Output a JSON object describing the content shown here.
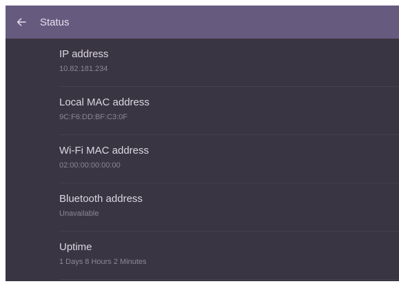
{
  "appbar": {
    "title": "Status",
    "back_icon": "arrow-left-icon"
  },
  "colors": {
    "appbar_bg": "#675a7f",
    "content_bg": "#3a3542",
    "title_text": "#dcd8e2",
    "value_text": "#8d8896"
  },
  "items": [
    {
      "title": "IP address",
      "value": "10.82.181.234"
    },
    {
      "title": "Local MAC address",
      "value": "9C:F6:DD:BF:C3:0F"
    },
    {
      "title": "Wi-Fi MAC address",
      "value": "02:00:00:00:00:00"
    },
    {
      "title": "Bluetooth address",
      "value": "Unavailable"
    },
    {
      "title": "Uptime",
      "value": "1 Days 8 Hours 2 Minutes"
    }
  ]
}
